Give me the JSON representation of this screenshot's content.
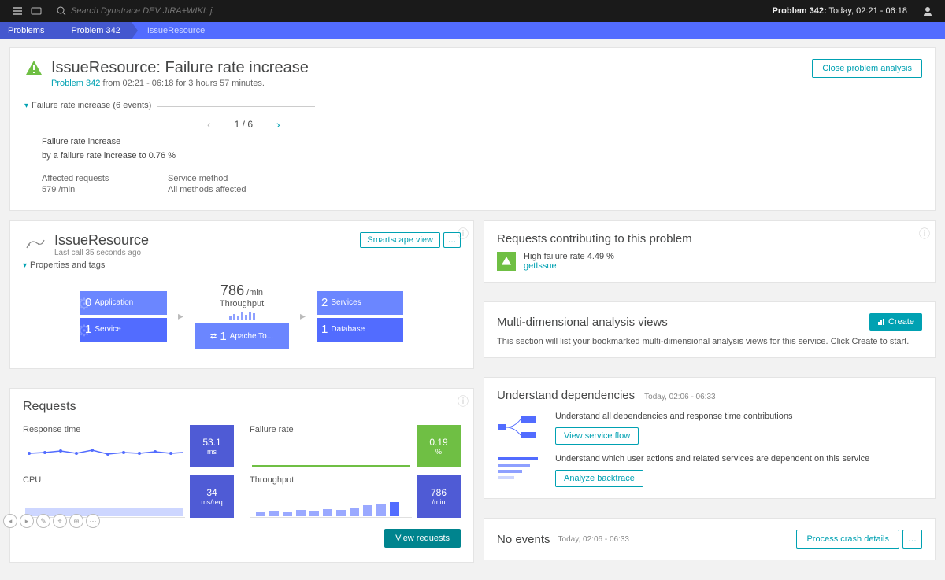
{
  "topbar": {
    "search_placeholder": "Search Dynatrace DEV JIRA+WIKI: jira...",
    "problem_label_prefix": "Problem 342:",
    "problem_label_time": "Today, 02:21 - 06:18"
  },
  "breadcrumb": {
    "root": "Problems",
    "mid": "Problem 342",
    "leaf": "IssueResource"
  },
  "problem_header": {
    "title": "IssueResource: Failure rate increase",
    "link": "Problem 342",
    "time_desc": "from 02:21 - 06:18 for 3 hours 57 minutes.",
    "close_btn": "Close problem analysis",
    "collapse": "Failure rate increase (6 events)",
    "pager": "1 / 6",
    "line1": "Failure rate increase",
    "line2": "by a failure rate increase to 0.76 %",
    "k1": "Affected requests",
    "v1": "579 /min",
    "k2": "Service method",
    "v2": "All methods affected"
  },
  "service_card": {
    "title": "IssueResource",
    "subtitle": "Last call 35 seconds ago",
    "smartscape": "Smartscape view",
    "props": "Properties and tags",
    "tp_num": "786",
    "tp_unit": "/min",
    "tp_label": "Throughput",
    "t_app_n": "0",
    "t_app_l": "Application",
    "t_svc_n": "1",
    "t_svc_l": "Service",
    "t_apache_n": "1",
    "t_apache_l": "Apache To...",
    "t_svcs_n": "2",
    "t_svcs_l": "Services",
    "t_db_n": "1",
    "t_db_l": "Database"
  },
  "requests": {
    "title": "Requests",
    "m1_label": "Response time",
    "m1_val": "53.1",
    "m1_unit": "ms",
    "m2_label": "Failure rate",
    "m2_val": "0.19",
    "m2_unit": "%",
    "m3_label": "CPU",
    "m3_val": "34",
    "m3_unit": "ms/req",
    "m4_label": "Throughput",
    "m4_val": "786",
    "m4_unit": "/min",
    "view_btn": "View requests"
  },
  "contrib": {
    "title": "Requests contributing to this problem",
    "line": "High failure rate 4.49 %",
    "link": "getIssue"
  },
  "mda": {
    "title": "Multi-dimensional analysis views",
    "create": "Create",
    "desc": "This section will list your bookmarked multi-dimensional analysis views for this service. Click Create to start."
  },
  "deps": {
    "title": "Understand dependencies",
    "ts": "Today, 02:06 - 06:33",
    "d1_txt": "Understand all dependencies and response time contributions",
    "d1_btn": "View service flow",
    "d2_txt": "Understand which user actions and related services are dependent on this service",
    "d2_btn": "Analyze backtrace"
  },
  "noevents": {
    "title": "No events",
    "ts": "Today, 02:06 - 06:33",
    "btn": "Process crash details"
  },
  "chart_data": [
    {
      "type": "line",
      "title": "Response time",
      "values": [
        52,
        53,
        54,
        52,
        55,
        51,
        53,
        52,
        54,
        53,
        52,
        53
      ],
      "ylim": [
        0,
        80
      ],
      "summary_value": 53.1,
      "unit": "ms"
    },
    {
      "type": "line",
      "title": "Failure rate",
      "values": [
        0.15,
        0.18,
        0.2,
        0.17,
        0.19,
        0.2,
        0.18,
        0.19,
        0.2,
        0.18,
        0.19,
        0.19
      ],
      "ylim": [
        0,
        1
      ],
      "summary_value": 0.19,
      "unit": "%"
    },
    {
      "type": "area",
      "title": "CPU",
      "values": [
        30,
        32,
        33,
        34,
        33,
        35,
        34,
        33,
        34,
        35,
        34,
        34
      ],
      "ylim": [
        0,
        60
      ],
      "summary_value": 34,
      "unit": "ms/req"
    },
    {
      "type": "bar",
      "title": "Throughput",
      "values": [
        400,
        420,
        450,
        430,
        500,
        460,
        520,
        540,
        700,
        760,
        780,
        786
      ],
      "ylim": [
        0,
        1000
      ],
      "summary_value": 786,
      "unit": "/min"
    }
  ]
}
